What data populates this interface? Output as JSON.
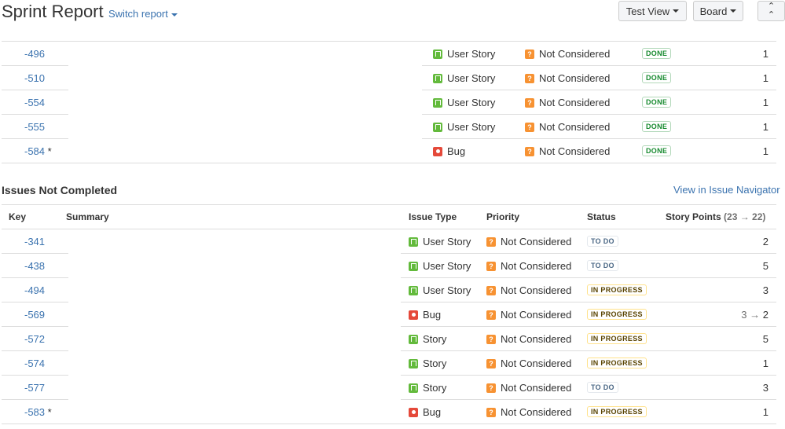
{
  "header": {
    "title": "Sprint Report",
    "switch_report": "Switch report",
    "test_view": "Test View",
    "board": "Board"
  },
  "completed": [
    {
      "key": "-496",
      "mark": "",
      "type": "User Story",
      "type_icon": "story-icon",
      "priority": "Not Considered",
      "status": "DONE",
      "points": "1"
    },
    {
      "key": "-510",
      "mark": "",
      "type": "User Story",
      "type_icon": "story-icon",
      "priority": "Not Considered",
      "status": "DONE",
      "points": "1"
    },
    {
      "key": "-554",
      "mark": "",
      "type": "User Story",
      "type_icon": "story-icon",
      "priority": "Not Considered",
      "status": "DONE",
      "points": "1"
    },
    {
      "key": "-555",
      "mark": "",
      "type": "User Story",
      "type_icon": "story-icon",
      "priority": "Not Considered",
      "status": "DONE",
      "points": "1"
    },
    {
      "key": "-584",
      "mark": " *",
      "type": "Bug",
      "type_icon": "bug-icon",
      "priority": "Not Considered",
      "status": "DONE",
      "points": "1"
    }
  ],
  "not_completed": {
    "title": "Issues Not Completed",
    "view_link": "View in Issue Navigator",
    "columns": {
      "key": "Key",
      "summary": "Summary",
      "issue_type": "Issue Type",
      "priority": "Priority",
      "status": "Status",
      "story_points": "Story Points",
      "points_range": "(23 → 22)"
    },
    "rows": [
      {
        "key": "-341",
        "mark": "",
        "type": "User Story",
        "type_icon": "story-icon",
        "priority": "Not Considered",
        "status": "TO DO",
        "points": "2",
        "old_points": ""
      },
      {
        "key": "-438",
        "mark": "",
        "type": "User Story",
        "type_icon": "story-icon",
        "priority": "Not Considered",
        "status": "TO DO",
        "points": "5",
        "old_points": ""
      },
      {
        "key": "-494",
        "mark": "",
        "type": "User Story",
        "type_icon": "story-icon",
        "priority": "Not Considered",
        "status": "IN PROGRESS",
        "points": "3",
        "old_points": ""
      },
      {
        "key": "-569",
        "mark": "",
        "type": "Bug",
        "type_icon": "bug-icon",
        "priority": "Not Considered",
        "status": "IN PROGRESS",
        "points": "2",
        "old_points": "3 → "
      },
      {
        "key": "-572",
        "mark": "",
        "type": "Story",
        "type_icon": "story-icon",
        "priority": "Not Considered",
        "status": "IN PROGRESS",
        "points": "5",
        "old_points": ""
      },
      {
        "key": "-574",
        "mark": "",
        "type": "Story",
        "type_icon": "story-icon",
        "priority": "Not Considered",
        "status": "IN PROGRESS",
        "points": "1",
        "old_points": ""
      },
      {
        "key": "-577",
        "mark": "",
        "type": "Story",
        "type_icon": "story-icon",
        "priority": "Not Considered",
        "status": "TO DO",
        "points": "3",
        "old_points": ""
      },
      {
        "key": "-583",
        "mark": " *",
        "type": "Bug",
        "type_icon": "bug-icon",
        "priority": "Not Considered",
        "status": "IN PROGRESS",
        "points": "1",
        "old_points": ""
      }
    ]
  }
}
